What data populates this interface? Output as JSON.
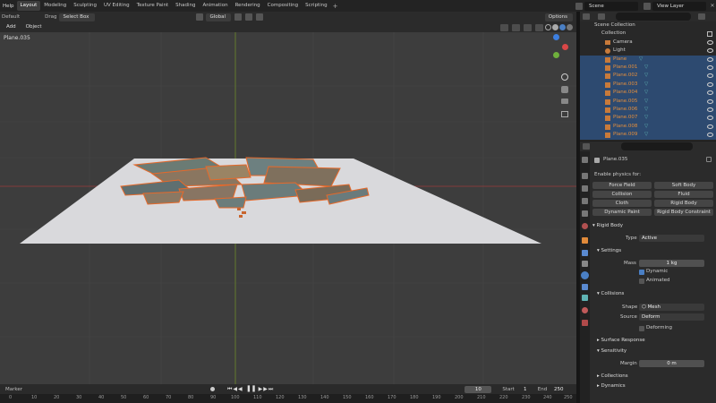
{
  "topbar": {
    "menu": "Help",
    "workspaces": [
      "Layout",
      "Modeling",
      "Sculpting",
      "UV Editing",
      "Texture Paint",
      "Shading",
      "Animation",
      "Rendering",
      "Compositing",
      "Scripting"
    ],
    "active_workspace": "Layout",
    "scene": "Scene",
    "view_layer": "View Layer"
  },
  "viewport_header": {
    "mode": "Default",
    "drag_label": "Drag",
    "select_mode": "Select Box",
    "transform": "Global",
    "options": "Options",
    "add": "Add",
    "object": "Object"
  },
  "viewport": {
    "label": "Plane.035"
  },
  "outliner": {
    "scene_collection": "Scene Collection",
    "collection": "Collection",
    "items": [
      {
        "name": "Camera",
        "selected": false,
        "color": "#dddddd"
      },
      {
        "name": "Light",
        "selected": false,
        "color": "#dddddd"
      },
      {
        "name": "Plane",
        "selected": true,
        "color": "#e58f3c"
      },
      {
        "name": "Plane.001",
        "selected": true,
        "color": "#e58f3c"
      },
      {
        "name": "Plane.002",
        "selected": true,
        "color": "#e58f3c"
      },
      {
        "name": "Plane.003",
        "selected": true,
        "color": "#e58f3c"
      },
      {
        "name": "Plane.004",
        "selected": true,
        "color": "#e58f3c"
      },
      {
        "name": "Plane.005",
        "selected": true,
        "color": "#e58f3c"
      },
      {
        "name": "Plane.006",
        "selected": true,
        "color": "#e58f3c"
      },
      {
        "name": "Plane.007",
        "selected": true,
        "color": "#e58f3c"
      },
      {
        "name": "Plane.008",
        "selected": true,
        "color": "#e58f3c"
      },
      {
        "name": "Plane.009",
        "selected": true,
        "color": "#e58f3c"
      }
    ]
  },
  "properties": {
    "object_name": "Plane.035",
    "enable_physics": "Enable physics for:",
    "physics_buttons": [
      "Force Field",
      "Soft Body",
      "Collision",
      "Fluid",
      "Cloth",
      "Rigid Body",
      "Dynamic Paint",
      "Rigid Body Constraint"
    ],
    "rigid_body": "Rigid Body",
    "type_label": "Type",
    "type_value": "Active",
    "settings": "Settings",
    "mass_label": "Mass",
    "mass_value": "1 kg",
    "dynamic": "Dynamic",
    "animated": "Animated",
    "collisions": "Collisions",
    "shape_label": "Shape",
    "shape_value": "Mesh",
    "source_label": "Source",
    "source_value": "Deform",
    "deforming": "Deforming",
    "surface_response": "Surface Response",
    "sensitivity": "Sensitivity",
    "margin_label": "Margin",
    "margin_value": "0 m",
    "collections": "Collections",
    "dynamics": "Dynamics"
  },
  "timeline": {
    "marker": "Marker",
    "current_frame": "10",
    "start_label": "Start",
    "start_value": "1",
    "end_label": "End",
    "end_value": "250",
    "ticks": [
      "0",
      "10",
      "20",
      "30",
      "40",
      "50",
      "60",
      "70",
      "80",
      "90",
      "100",
      "110",
      "120",
      "130",
      "140",
      "150",
      "160",
      "170",
      "180",
      "190",
      "200",
      "210",
      "220",
      "230",
      "240",
      "250"
    ]
  },
  "colors": {
    "accent": "#4a7fc4",
    "selection": "#e58f3c",
    "outliner_selected": "#2d4a70",
    "x_axis": "#9a3b3b",
    "y_axis": "#6d8a2a"
  }
}
